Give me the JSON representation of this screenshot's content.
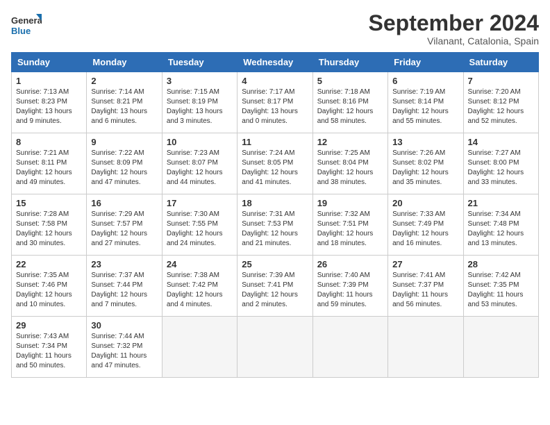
{
  "logo": {
    "line1": "General",
    "line2": "Blue"
  },
  "title": "September 2024",
  "location": "Vilanant, Catalonia, Spain",
  "days_header": [
    "Sunday",
    "Monday",
    "Tuesday",
    "Wednesday",
    "Thursday",
    "Friday",
    "Saturday"
  ],
  "weeks": [
    [
      {
        "day": "1",
        "sunrise": "Sunrise: 7:13 AM",
        "sunset": "Sunset: 8:23 PM",
        "daylight": "Daylight: 13 hours and 9 minutes."
      },
      {
        "day": "2",
        "sunrise": "Sunrise: 7:14 AM",
        "sunset": "Sunset: 8:21 PM",
        "daylight": "Daylight: 13 hours and 6 minutes."
      },
      {
        "day": "3",
        "sunrise": "Sunrise: 7:15 AM",
        "sunset": "Sunset: 8:19 PM",
        "daylight": "Daylight: 13 hours and 3 minutes."
      },
      {
        "day": "4",
        "sunrise": "Sunrise: 7:17 AM",
        "sunset": "Sunset: 8:17 PM",
        "daylight": "Daylight: 13 hours and 0 minutes."
      },
      {
        "day": "5",
        "sunrise": "Sunrise: 7:18 AM",
        "sunset": "Sunset: 8:16 PM",
        "daylight": "Daylight: 12 hours and 58 minutes."
      },
      {
        "day": "6",
        "sunrise": "Sunrise: 7:19 AM",
        "sunset": "Sunset: 8:14 PM",
        "daylight": "Daylight: 12 hours and 55 minutes."
      },
      {
        "day": "7",
        "sunrise": "Sunrise: 7:20 AM",
        "sunset": "Sunset: 8:12 PM",
        "daylight": "Daylight: 12 hours and 52 minutes."
      }
    ],
    [
      {
        "day": "8",
        "sunrise": "Sunrise: 7:21 AM",
        "sunset": "Sunset: 8:11 PM",
        "daylight": "Daylight: 12 hours and 49 minutes."
      },
      {
        "day": "9",
        "sunrise": "Sunrise: 7:22 AM",
        "sunset": "Sunset: 8:09 PM",
        "daylight": "Daylight: 12 hours and 47 minutes."
      },
      {
        "day": "10",
        "sunrise": "Sunrise: 7:23 AM",
        "sunset": "Sunset: 8:07 PM",
        "daylight": "Daylight: 12 hours and 44 minutes."
      },
      {
        "day": "11",
        "sunrise": "Sunrise: 7:24 AM",
        "sunset": "Sunset: 8:05 PM",
        "daylight": "Daylight: 12 hours and 41 minutes."
      },
      {
        "day": "12",
        "sunrise": "Sunrise: 7:25 AM",
        "sunset": "Sunset: 8:04 PM",
        "daylight": "Daylight: 12 hours and 38 minutes."
      },
      {
        "day": "13",
        "sunrise": "Sunrise: 7:26 AM",
        "sunset": "Sunset: 8:02 PM",
        "daylight": "Daylight: 12 hours and 35 minutes."
      },
      {
        "day": "14",
        "sunrise": "Sunrise: 7:27 AM",
        "sunset": "Sunset: 8:00 PM",
        "daylight": "Daylight: 12 hours and 33 minutes."
      }
    ],
    [
      {
        "day": "15",
        "sunrise": "Sunrise: 7:28 AM",
        "sunset": "Sunset: 7:58 PM",
        "daylight": "Daylight: 12 hours and 30 minutes."
      },
      {
        "day": "16",
        "sunrise": "Sunrise: 7:29 AM",
        "sunset": "Sunset: 7:57 PM",
        "daylight": "Daylight: 12 hours and 27 minutes."
      },
      {
        "day": "17",
        "sunrise": "Sunrise: 7:30 AM",
        "sunset": "Sunset: 7:55 PM",
        "daylight": "Daylight: 12 hours and 24 minutes."
      },
      {
        "day": "18",
        "sunrise": "Sunrise: 7:31 AM",
        "sunset": "Sunset: 7:53 PM",
        "daylight": "Daylight: 12 hours and 21 minutes."
      },
      {
        "day": "19",
        "sunrise": "Sunrise: 7:32 AM",
        "sunset": "Sunset: 7:51 PM",
        "daylight": "Daylight: 12 hours and 18 minutes."
      },
      {
        "day": "20",
        "sunrise": "Sunrise: 7:33 AM",
        "sunset": "Sunset: 7:49 PM",
        "daylight": "Daylight: 12 hours and 16 minutes."
      },
      {
        "day": "21",
        "sunrise": "Sunrise: 7:34 AM",
        "sunset": "Sunset: 7:48 PM",
        "daylight": "Daylight: 12 hours and 13 minutes."
      }
    ],
    [
      {
        "day": "22",
        "sunrise": "Sunrise: 7:35 AM",
        "sunset": "Sunset: 7:46 PM",
        "daylight": "Daylight: 12 hours and 10 minutes."
      },
      {
        "day": "23",
        "sunrise": "Sunrise: 7:37 AM",
        "sunset": "Sunset: 7:44 PM",
        "daylight": "Daylight: 12 hours and 7 minutes."
      },
      {
        "day": "24",
        "sunrise": "Sunrise: 7:38 AM",
        "sunset": "Sunset: 7:42 PM",
        "daylight": "Daylight: 12 hours and 4 minutes."
      },
      {
        "day": "25",
        "sunrise": "Sunrise: 7:39 AM",
        "sunset": "Sunset: 7:41 PM",
        "daylight": "Daylight: 12 hours and 2 minutes."
      },
      {
        "day": "26",
        "sunrise": "Sunrise: 7:40 AM",
        "sunset": "Sunset: 7:39 PM",
        "daylight": "Daylight: 11 hours and 59 minutes."
      },
      {
        "day": "27",
        "sunrise": "Sunrise: 7:41 AM",
        "sunset": "Sunset: 7:37 PM",
        "daylight": "Daylight: 11 hours and 56 minutes."
      },
      {
        "day": "28",
        "sunrise": "Sunrise: 7:42 AM",
        "sunset": "Sunset: 7:35 PM",
        "daylight": "Daylight: 11 hours and 53 minutes."
      }
    ],
    [
      {
        "day": "29",
        "sunrise": "Sunrise: 7:43 AM",
        "sunset": "Sunset: 7:34 PM",
        "daylight": "Daylight: 11 hours and 50 minutes."
      },
      {
        "day": "30",
        "sunrise": "Sunrise: 7:44 AM",
        "sunset": "Sunset: 7:32 PM",
        "daylight": "Daylight: 11 hours and 47 minutes."
      },
      null,
      null,
      null,
      null,
      null
    ]
  ]
}
